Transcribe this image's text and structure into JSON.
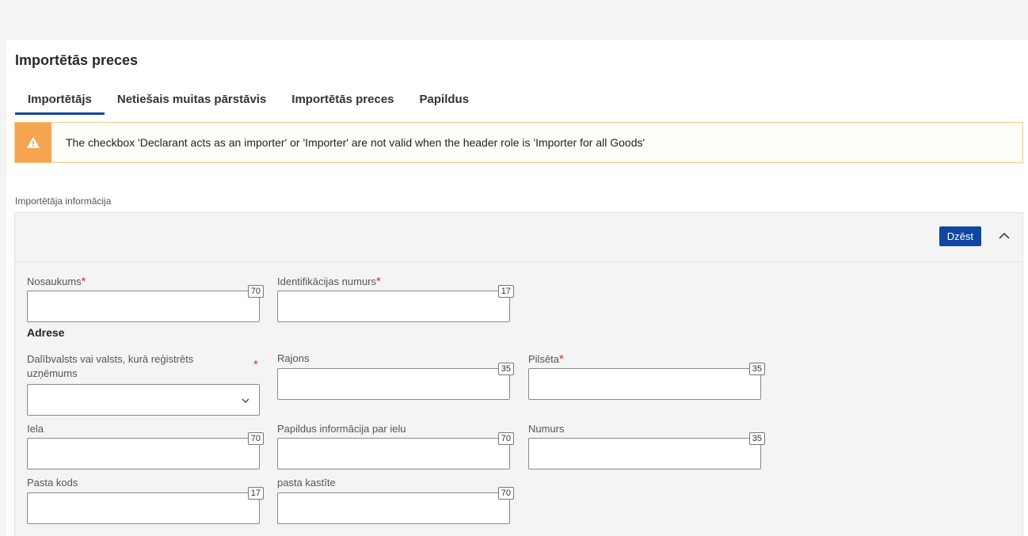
{
  "page": {
    "title": "Importētās preces"
  },
  "tabs": [
    {
      "label": "Importētājs",
      "active": true
    },
    {
      "label": "Netiešais muitas pārstāvis",
      "active": false
    },
    {
      "label": "Importētās preces",
      "active": false
    },
    {
      "label": "Papildus",
      "active": false
    }
  ],
  "warning": {
    "icon": "warning-triangle-icon",
    "text": "The checkbox 'Declarant acts as an importer' or 'Importer' are not valid when the header role is 'Importer for all Goods'",
    "color": "#f6a550"
  },
  "section": {
    "label": "Importētāja informācija"
  },
  "panel": {
    "delete_label": "Dzēst",
    "accent": "#0e47a1",
    "collapse_icon": "chevron-up-icon"
  },
  "fields": {
    "name": {
      "label": "Nosaukums",
      "required": "*",
      "max": "70",
      "value": ""
    },
    "id_number": {
      "label": "Identifikācijas numurs",
      "required": "*",
      "max": "17",
      "value": ""
    },
    "address_heading": "Adrese",
    "country": {
      "label": "Dalībvalsts vai valsts, kurā reģistrēts uzņēmums",
      "required": "*",
      "value": ""
    },
    "district": {
      "label": "Rajons",
      "max": "35",
      "value": ""
    },
    "city": {
      "label": "Pilsēta",
      "required": "*",
      "max": "35",
      "value": ""
    },
    "street": {
      "label": "Iela",
      "max": "70",
      "value": ""
    },
    "street_extra": {
      "label": "Papildus informācija par ielu",
      "max": "70",
      "value": ""
    },
    "number": {
      "label": "Numurs",
      "max": "35",
      "value": ""
    },
    "postcode": {
      "label": "Pasta kods",
      "max": "17",
      "value": ""
    },
    "pobox": {
      "label": "pasta kastīte",
      "max": "70",
      "value": ""
    }
  }
}
